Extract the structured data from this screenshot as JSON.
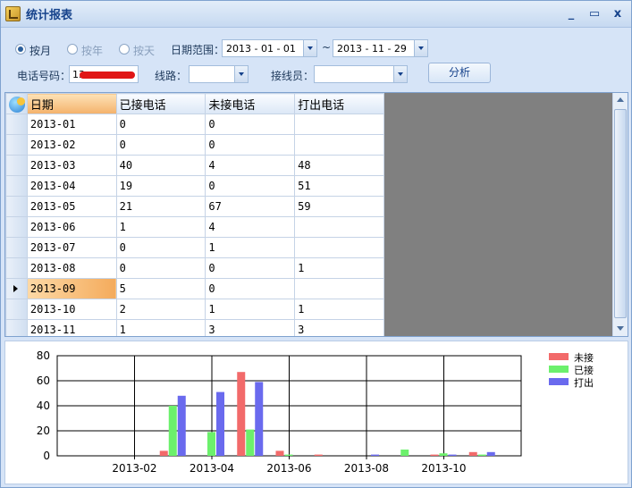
{
  "window": {
    "title": "统计报表",
    "min_glyph": "_",
    "max_glyph": "▭",
    "close_glyph": "x"
  },
  "filters": {
    "radio_month": "按月",
    "radio_year": "按年",
    "radio_day": "按天",
    "selected_mode": "按月",
    "date_range_label": "日期范围：",
    "date_from": "2013 - 01 - 01",
    "tilde": "~",
    "date_to": "2013 - 11 - 29",
    "phone_label": "电话号码：",
    "phone_value": "13",
    "line_label": "线路：",
    "line_value": "",
    "operator_label": "接线员：",
    "operator_value": "",
    "analyze_button": "分析"
  },
  "grid": {
    "columns": [
      "日期",
      "已接电话",
      "未接电话",
      "打出电话"
    ],
    "rows": [
      [
        "2013-01",
        "0",
        "0",
        ""
      ],
      [
        "2013-02",
        "0",
        "0",
        ""
      ],
      [
        "2013-03",
        "40",
        "4",
        "48"
      ],
      [
        "2013-04",
        "19",
        "0",
        "51"
      ],
      [
        "2013-05",
        "21",
        "67",
        "59"
      ],
      [
        "2013-06",
        "1",
        "4",
        ""
      ],
      [
        "2013-07",
        "0",
        "1",
        ""
      ],
      [
        "2013-08",
        "0",
        "0",
        "1"
      ],
      [
        "2013-09",
        "5",
        "0",
        ""
      ],
      [
        "2013-10",
        "2",
        "1",
        "1"
      ],
      [
        "2013-11",
        "1",
        "3",
        "3"
      ]
    ],
    "selected_row": "2013-09"
  },
  "chart_data": {
    "type": "bar",
    "categories": [
      "2013-01",
      "2013-02",
      "2013-03",
      "2013-04",
      "2013-05",
      "2013-06",
      "2013-07",
      "2013-08",
      "2013-09",
      "2013-10",
      "2013-11"
    ],
    "x_tick_labels": [
      "2013-02",
      "2013-04",
      "2013-06",
      "2013-08",
      "2013-10"
    ],
    "series": [
      {
        "name": "未接",
        "color": "#f26a6a",
        "values": [
          0,
          0,
          4,
          0,
          67,
          4,
          1,
          0,
          0,
          1,
          3
        ]
      },
      {
        "name": "已接",
        "color": "#6cf06c",
        "values": [
          0,
          0,
          40,
          19,
          21,
          1,
          0,
          0,
          5,
          2,
          1
        ]
      },
      {
        "name": "打出",
        "color": "#6a6aee",
        "values": [
          0,
          0,
          48,
          51,
          59,
          0,
          0,
          1,
          0,
          1,
          3
        ]
      }
    ],
    "ylim": [
      0,
      80
    ],
    "y_ticks": [
      0,
      20,
      40,
      60,
      80
    ],
    "grid": true,
    "legend_position": "top-right"
  }
}
